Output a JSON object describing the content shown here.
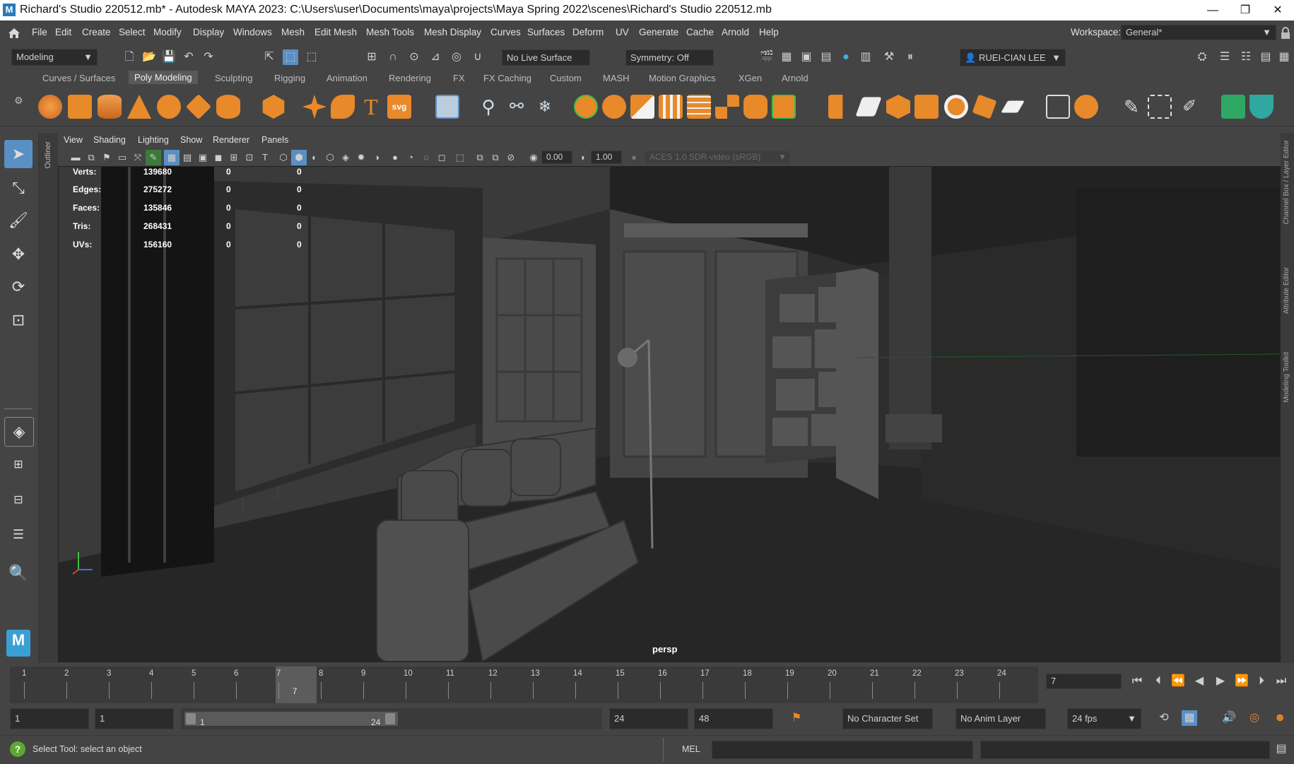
{
  "window": {
    "title": "Richard's Studio 220512.mb* - Autodesk MAYA 2023: C:\\Users\\user\\Documents\\maya\\projects\\Maya Spring 2022\\scenes\\Richard's Studio 220512.mb",
    "app_icon": "M",
    "minimize": "—",
    "restore": "❐",
    "close": "✕"
  },
  "menubar": {
    "items": [
      "File",
      "Edit",
      "Create",
      "Select",
      "Modify",
      "Display",
      "Windows",
      "Mesh",
      "Edit Mesh",
      "Mesh Tools",
      "Mesh Display",
      "Curves",
      "Surfaces",
      "Deform",
      "UV",
      "Generate",
      "Cache",
      "Arnold",
      "Help"
    ],
    "workspace_label": "Workspace:",
    "workspace_value": "General*"
  },
  "statusline": {
    "menuset": "Modeling",
    "live_surface": "No Live Surface",
    "symmetry": "Symmetry: Off",
    "user": "RUEI-CIAN LEE"
  },
  "shelf": {
    "tabs": [
      "Curves / Surfaces",
      "Poly Modeling",
      "Sculpting",
      "Rigging",
      "Animation",
      "Rendering",
      "FX",
      "FX Caching",
      "Custom",
      "MASH",
      "Motion Graphics",
      "XGen",
      "Arnold"
    ],
    "active_tab": "Poly Modeling",
    "text_icon": "T",
    "svg_icon": "svg"
  },
  "viewport": {
    "menus": [
      "View",
      "Shading",
      "Lighting",
      "Show",
      "Renderer",
      "Panels"
    ],
    "exposure": "0.00",
    "gamma": "1.00",
    "color_space": "ACES 1.0 SDR-video (sRGB)",
    "camera": "persp",
    "hud": [
      {
        "label": "Verts:",
        "v1": "139680",
        "v2": "0",
        "v3": "0"
      },
      {
        "label": "Edges:",
        "v1": "275272",
        "v2": "0",
        "v3": "0"
      },
      {
        "label": "Faces:",
        "v1": "135846",
        "v2": "0",
        "v3": "0"
      },
      {
        "label": "Tris:",
        "v1": "268431",
        "v2": "0",
        "v3": "0"
      },
      {
        "label": "UVs:",
        "v1": "156160",
        "v2": "0",
        "v3": "0"
      }
    ]
  },
  "side_labels": {
    "outliner": "Outliner",
    "channel_box": "Channel Box / Layer Editor",
    "attribute_editor": "Attribute Editor",
    "modeling_toolkit": "Modeling Toolkit"
  },
  "timeslider": {
    "ticks": [
      "1",
      "2",
      "3",
      "4",
      "5",
      "6",
      "7",
      "8",
      "9",
      "10",
      "11",
      "12",
      "13",
      "14",
      "15",
      "16",
      "17",
      "18",
      "19",
      "20",
      "21",
      "22",
      "23",
      "24"
    ],
    "current_frame": "7",
    "current_frame_field": "7"
  },
  "rangeslider": {
    "start": "1",
    "playback_start": "1",
    "range_start": "1",
    "range_end": "24",
    "playback_end": "24",
    "end": "48",
    "character_set": "No Character Set",
    "anim_layer": "No Anim Layer",
    "fps": "24 fps"
  },
  "helpline": {
    "message": "Select Tool: select an object",
    "language": "MEL"
  },
  "colors": {
    "ui_bg": "#444444",
    "shelf_orange": "#e8892a",
    "highlight_blue": "#5a8fc4",
    "viewport_bg": "#2e2e2e"
  }
}
